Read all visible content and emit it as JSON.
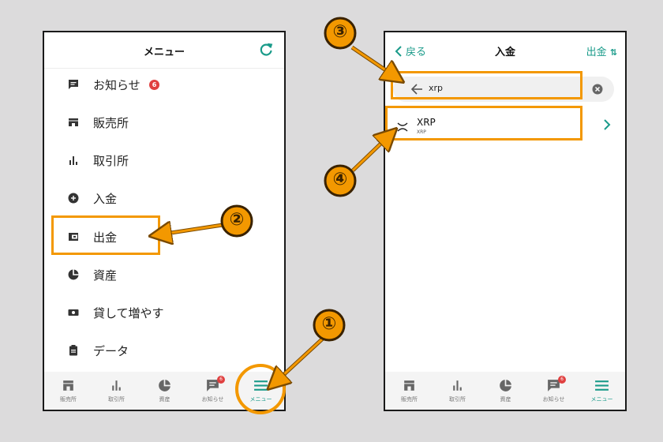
{
  "left_screen": {
    "title": "メニュー",
    "menu_items": [
      {
        "label": "お知らせ",
        "badge": "6"
      },
      {
        "label": "販売所"
      },
      {
        "label": "取引所"
      },
      {
        "label": "入金"
      },
      {
        "label": "出金"
      },
      {
        "label": "資産"
      },
      {
        "label": "貸して増やす"
      },
      {
        "label": "データ"
      }
    ]
  },
  "right_screen": {
    "back_label": "戻る",
    "title": "入金",
    "withdraw_label": "出金",
    "search_value": "xrp",
    "coin": {
      "symbol": "XRP",
      "subtitle": "XRP"
    }
  },
  "tabbar": {
    "items": [
      {
        "label": "販売所"
      },
      {
        "label": "取引所"
      },
      {
        "label": "資産"
      },
      {
        "label": "お知らせ",
        "badge": "6"
      },
      {
        "label": "メニュー"
      }
    ]
  },
  "callouts": [
    "①",
    "②",
    "③",
    "④"
  ],
  "colors": {
    "accent": "#1a9b8a",
    "highlight": "#f39800",
    "badge": "#e04040"
  }
}
